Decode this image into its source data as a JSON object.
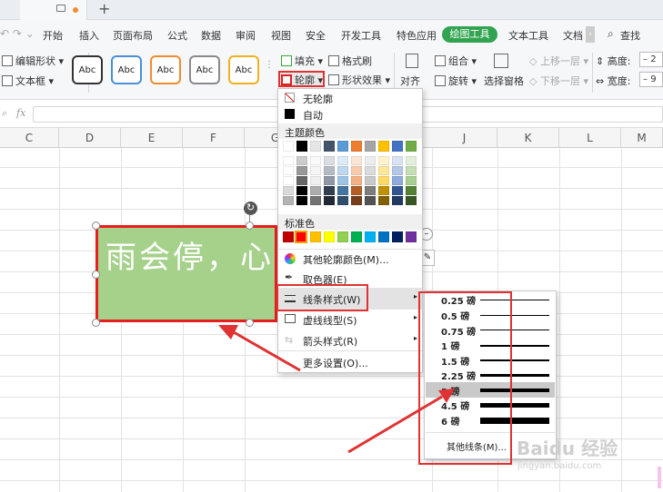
{
  "titlebar": {
    "tab_icons": [
      "monitor-icon",
      "dot-icon"
    ],
    "new_tab": "+"
  },
  "menu": {
    "items": [
      "开始",
      "插入",
      "页面布局",
      "公式",
      "数据",
      "审阅",
      "视图",
      "安全",
      "开发工具",
      "特色应用",
      "绘图工具",
      "文本工具",
      "文档"
    ],
    "active": "绘图工具",
    "search": "查找"
  },
  "ribbon": {
    "edit_shape": "编辑形状",
    "text_box": "文本框",
    "styles": [
      "Abc",
      "Abc",
      "Abc",
      "Abc",
      "Abc"
    ],
    "style_colors": [
      "#333333",
      "#4a90d9",
      "#f08c2e",
      "#8a8a8a",
      "#f0b020"
    ],
    "fill": "填充",
    "format_brush": "格式刷",
    "outline": "轮廓",
    "shape_effect": "形状效果",
    "align": "对齐",
    "group": "组合",
    "rotate": "旋转",
    "selection_pane": "选择窗格",
    "bring_forward": "上移一层",
    "send_backward": "下移一层",
    "height_label": "高度:",
    "width_label": "宽度:",
    "height_val": "2",
    "width_val": "9"
  },
  "formula": {
    "fx": "fx"
  },
  "columns": [
    "C",
    "D",
    "E",
    "F",
    "G",
    "J",
    "K",
    "L",
    "M"
  ],
  "shape": {
    "text": "雨会停，心",
    "fill": "#a5d18b",
    "border": "#e81d1d"
  },
  "dropdown": {
    "no_outline": "无轮廓",
    "auto": "自动",
    "theme_colors": "主题颜色",
    "standard_colors": "标准色",
    "more_colors": "其他轮廓颜色(M)...",
    "eyedropper": "取色器(E)",
    "line_style": "线条样式(W)",
    "dash_style": "虚线线型(S)",
    "arrow_style": "箭头样式(R)",
    "more_settings": "更多设置(O)...",
    "theme_top": [
      "#ffffff",
      "#000000",
      "#e7e6e6",
      "#44546a",
      "#5b9bd5",
      "#ed7d31",
      "#a5a5a5",
      "#ffc000",
      "#4472c4",
      "#70ad47"
    ],
    "standard": [
      "#c00000",
      "#ff0000",
      "#ffc000",
      "#ffff00",
      "#92d050",
      "#00b050",
      "#00b0f0",
      "#0070c0",
      "#002060",
      "#7030a0"
    ]
  },
  "submenu": {
    "weights": [
      "0.25 磅",
      "0.5 磅",
      "0.75 磅",
      "1 磅",
      "1.5 磅",
      "2.25 磅",
      "3 磅",
      "4.5 磅",
      "6 磅"
    ],
    "selected": "3 磅",
    "more_lines": "其他线条(M)..."
  },
  "watermark": {
    "brand": "Baidu 经验",
    "url": "jingyan.baidu.com"
  }
}
